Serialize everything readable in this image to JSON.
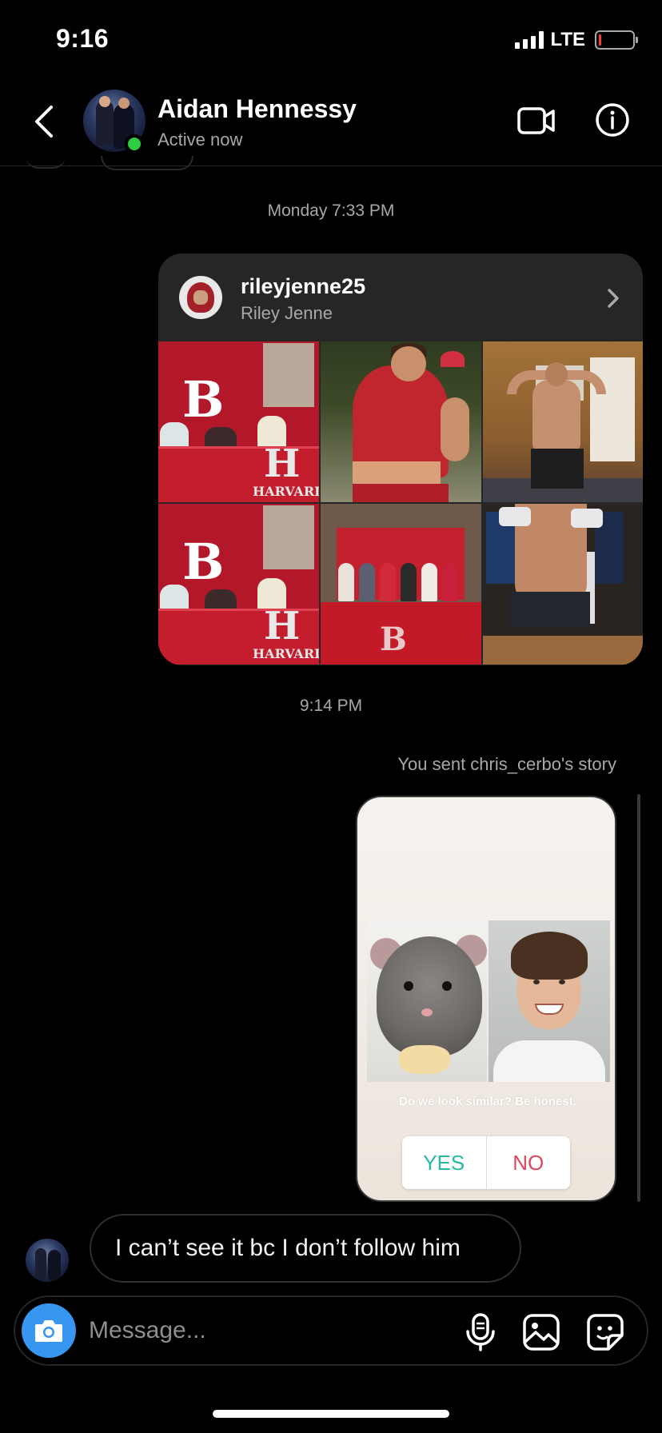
{
  "status_bar": {
    "time": "9:16",
    "network": "LTE",
    "battery_color": "#ff3b30"
  },
  "header": {
    "name": "Aidan Hennessy",
    "status": "Active now",
    "online_color": "#2ecc40",
    "icons": [
      "back-chevron-icon",
      "video-camera-icon",
      "info-icon"
    ]
  },
  "thread": {
    "timestamp_1": "Monday 7:33 PM",
    "shared_profile": {
      "username": "rileyjenne25",
      "full_name": "Riley Jenne",
      "tiles": [
        {
          "letter": "B",
          "banner": "H",
          "banner_text": "HARVARD"
        },
        {},
        {},
        {
          "letter": "B",
          "banner": "H",
          "banner_text": "HARVARD"
        },
        {
          "letter": "B"
        },
        {}
      ]
    },
    "timestamp_2": "9:14 PM",
    "story_caption": "You sent chris_cerbo's story",
    "story": {
      "question": "Do we look similar? Be honest.",
      "poll_yes": "YES",
      "poll_no": "NO",
      "yes_color": "#26b8a2",
      "no_color": "#e0475a"
    },
    "received_message": "I can’t see it bc I don’t follow him"
  },
  "composer": {
    "placeholder": "Message...",
    "camera_color": "#3797f0",
    "icons": [
      "camera-icon",
      "microphone-icon",
      "gallery-icon",
      "sticker-icon"
    ]
  }
}
